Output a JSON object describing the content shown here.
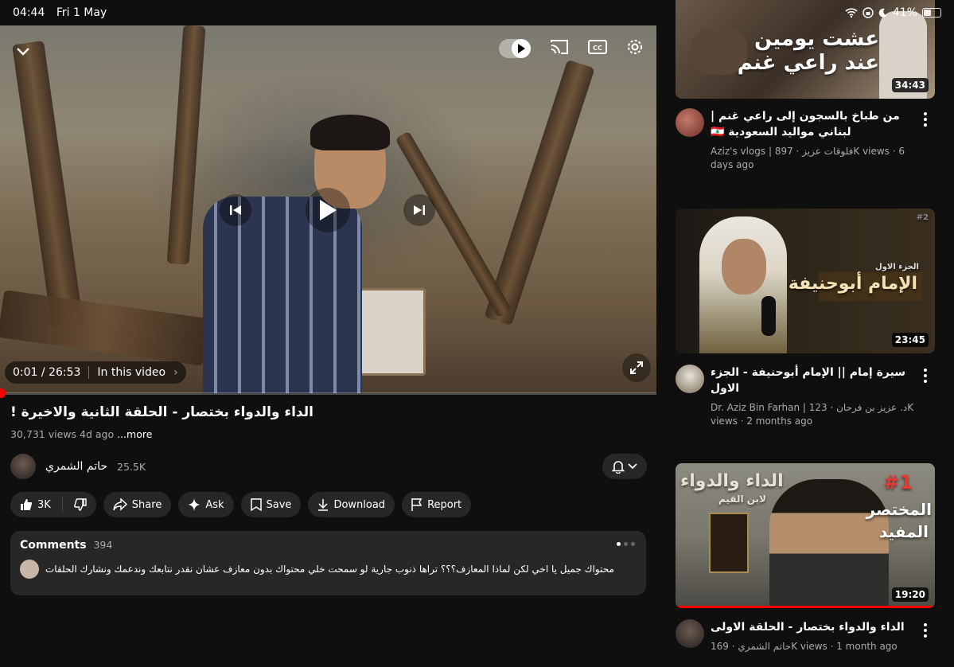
{
  "status_bar": {
    "time": "04:44",
    "date": "Fri 1 May",
    "battery": "41%"
  },
  "player": {
    "time": "0:01 / 26:53",
    "in_this_video": "In this video",
    "progress_fraction": 0.0006,
    "autoplay_on": true
  },
  "video": {
    "title": "الداء والدواء بختصار - الحلقة الثانية والاخيرة !",
    "views": "30,731 views",
    "age": "4d ago",
    "more": "...more"
  },
  "channel": {
    "name": "حاتم الشمري",
    "subscribers": "25.5K"
  },
  "actions": {
    "likes": "3K",
    "share": "Share",
    "ask": "Ask",
    "save": "Save",
    "download": "Download",
    "report": "Report"
  },
  "comments": {
    "label": "Comments",
    "count": "394",
    "top_comment": "محتواك جميل يا اخي لكن لماذا المعازف؟؟؟ تراها ذنوب جارية لو سمحت خلي محتواك بدون معازف عشان نقدر نتابعك وندعمك ونشارك الحلقات"
  },
  "related": [
    {
      "thumb_text_1": "عشت يومين",
      "thumb_text_2": "عند راعي غنم",
      "duration": "34:43",
      "title": "من طباخ بالسجون إلى راعي غنم | لبناني مواليد السعودية 🇱🇧",
      "meta": "Aziz's vlogs | فلوقات عزيز · 897K views · 6 days ago"
    },
    {
      "thumb_small": "الجزء الاول",
      "thumb_text": "الإمام أبوحنيفة",
      "thumb_num": "#2",
      "duration": "23:45",
      "title": "سيرة إمام || الإمام أبوحنيفة - الجزء الاول",
      "meta": "Dr. Aziz Bin Farhan | د. عزيز بن فرحان · 123K views · 2 months ago"
    },
    {
      "thumb_left": "الداء والدواء",
      "thumb_left_sub": "لابن القيم",
      "thumb_right_num": "#1",
      "thumb_right": "المختصر المفيد",
      "duration": "19:20",
      "title": "الداء والدواء بختصار - الحلقة الاولى",
      "meta": "حاتم الشمري · 169K views · 1 month ago"
    }
  ]
}
